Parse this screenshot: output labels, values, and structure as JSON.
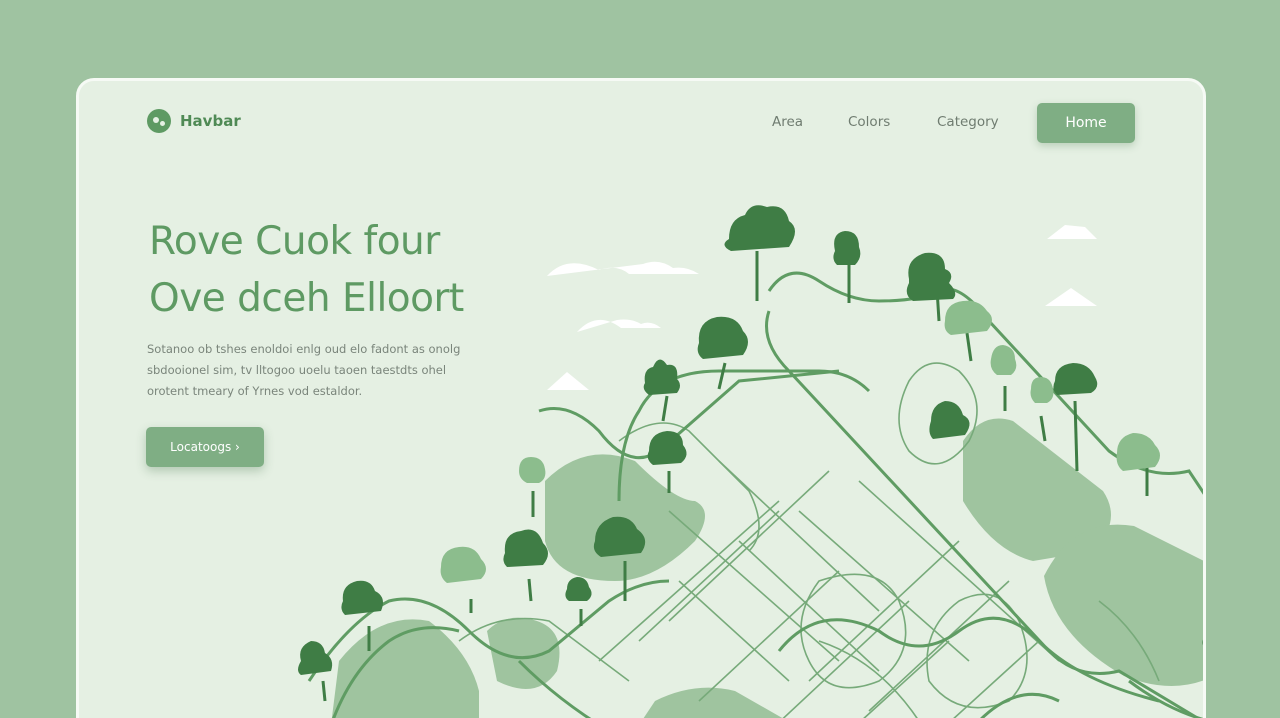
{
  "brand": {
    "name": "Havbar",
    "logo_icon": "leaf-globe-icon"
  },
  "nav": {
    "links": [
      "Area",
      "Colors",
      "Category"
    ],
    "home_label": "Home"
  },
  "hero": {
    "title_line1": "Rove Cuok four",
    "title_line2": "Ove dceh Elloort",
    "body_line1": "Sotanoo ob tshes enoldoi enlg oud elo fadont as onolg",
    "body_line2": "sbdooionel sim, tv lltogoo uoelu taoen taestdts ohel",
    "body_line3": "orotent tmeary of Yrnes vod estaldor.",
    "cta_label": "Locatoogs ›"
  },
  "colors": {
    "background": "#9fc3a1",
    "panel": "#e5f0e3",
    "accent": "#7fae84",
    "brand_text": "#5e9a63",
    "road": "#5f9c63",
    "tree_dark": "#3f7d45",
    "tree_light": "#8cbd8d"
  },
  "illustration": {
    "type": "map-with-trees-and-roads",
    "icons": [
      "tree-icon",
      "cloud-icon"
    ]
  }
}
